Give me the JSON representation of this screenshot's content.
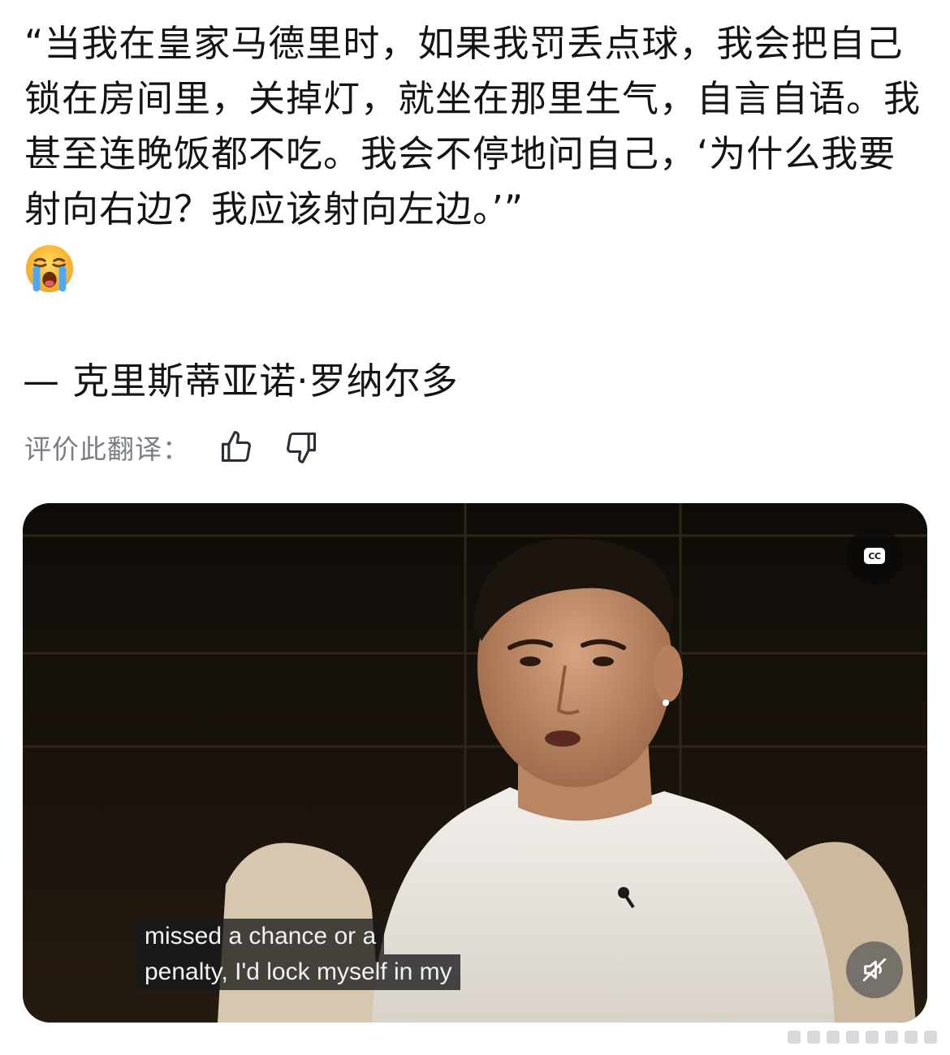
{
  "post": {
    "quote": "“当我在皇家马德里时，如果我罚丢点球，我会把自己锁在房间里，关掉灯，就坐在那里生气，自言自语。我甚至连晚饭都不吃。我会不停地问自己，‘为什么我要射向右边？我应该射向左边。’”",
    "emoji": "loudly-crying-face",
    "attribution": "— 克里斯蒂亚诺·罗纳尔多"
  },
  "rating": {
    "label": "评价此翻译：",
    "thumbs_up_icon": "thumbs-up-icon",
    "thumbs_down_icon": "thumbs-down-icon"
  },
  "video": {
    "cc_label": "CC",
    "subtitle_line1": "missed a chance or a",
    "subtitle_line2": "penalty, I'd lock myself in my",
    "mute_icon": "muted-speaker-icon"
  },
  "colors": {
    "text": "#141414",
    "secondary": "#7a7f86",
    "video_bg": "#16110b"
  }
}
